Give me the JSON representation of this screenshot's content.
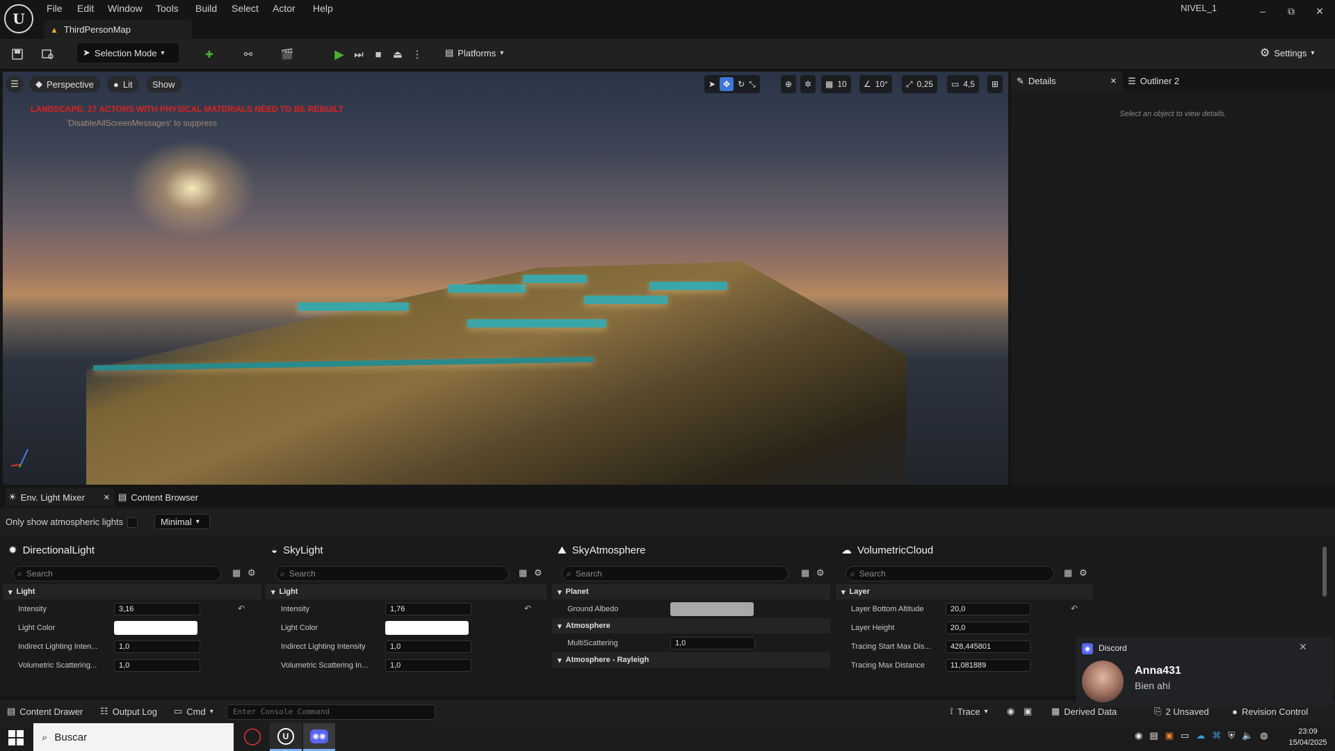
{
  "app": {
    "level": "NIVEL_1",
    "document_tab": "ThirdPersonMap"
  },
  "menu": [
    "File",
    "Edit",
    "Window",
    "Tools",
    "Build",
    "Select",
    "Actor",
    "Help"
  ],
  "window_controls": {
    "minimize": "–",
    "restore": "⧉",
    "close": "✕"
  },
  "toolbar": {
    "selection_mode": "Selection Mode",
    "platforms": "Platforms",
    "settings": "Settings"
  },
  "viewport": {
    "perspective": "Perspective",
    "lit": "Lit",
    "show": "Show",
    "grid_snap": "10",
    "rotation_snap": "10°",
    "scale_snap": "0,25",
    "camera_speed": "4,5",
    "message": "LANDSCAPE: 27 ACTORS WITH PHYSICAL MATERIALS NEED TO BE REBUILT",
    "message_hint": "'DisableAllScreenMessages' to suppress"
  },
  "details": {
    "tab": "Details",
    "outliner_tab": "Outliner 2",
    "empty": "Select an object to view details."
  },
  "bottom_tabs": {
    "light_mixer": "Env. Light Mixer",
    "content_browser": "Content Browser"
  },
  "light_mixer": {
    "only_show_label": "Only show atmospheric lights",
    "view_mode": "Minimal",
    "search_placeholder": "Search",
    "columns": [
      {
        "title": "DirectionalLight",
        "icon": "sun-icon",
        "sections": [
          {
            "name": "Light",
            "rows": [
              {
                "label": "Intensity",
                "value": "3,16"
              },
              {
                "label": "Light Color",
                "color": "#ffffff"
              },
              {
                "label": "Indirect Lighting Inten...",
                "value": "1,0"
              },
              {
                "label": "Volumetric Scattering...",
                "value": "1,0"
              }
            ]
          }
        ]
      },
      {
        "title": "SkyLight",
        "icon": "skylight-icon",
        "sections": [
          {
            "name": "Light",
            "rows": [
              {
                "label": "Intensity",
                "value": "1,76"
              },
              {
                "label": "Light Color",
                "color": "#ffffff"
              },
              {
                "label": "Indirect Lighting Intensity",
                "value": "1,0"
              },
              {
                "label": "Volumetric Scattering In...",
                "value": "1,0"
              }
            ]
          }
        ]
      },
      {
        "title": "SkyAtmosphere",
        "icon": "atmosphere-icon",
        "sections": [
          {
            "name": "Planet",
            "rows": [
              {
                "label": "Ground Albedo",
                "color": "#a8a8a8"
              }
            ]
          },
          {
            "name": "Atmosphere",
            "rows": [
              {
                "label": "MultiScattering",
                "value": "1,0"
              }
            ]
          },
          {
            "name": "Atmosphere - Rayleigh",
            "rows": []
          }
        ]
      },
      {
        "title": "VolumetricCloud",
        "icon": "cloud-icon",
        "sections": [
          {
            "name": "Layer",
            "rows": [
              {
                "label": "Layer Bottom Altitude",
                "value": "20,0"
              },
              {
                "label": "Layer Height",
                "value": "20,0"
              },
              {
                "label": "Tracing Start Max Dis...",
                "value": "428,445801"
              },
              {
                "label": "Tracing Max Distance",
                "value": "11,081889"
              }
            ]
          }
        ]
      }
    ]
  },
  "statusbar": {
    "content_drawer": "Content Drawer",
    "output_log": "Output Log",
    "cmd": "Cmd",
    "console_placeholder": "Enter Console Command",
    "trace": "Trace",
    "derived_data": "Derived Data",
    "unsaved": "2 Unsaved",
    "revision_control": "Revision Control"
  },
  "taskbar": {
    "search_placeholder": "Buscar",
    "time": "23:09",
    "date": "15/04/2025"
  },
  "notification": {
    "app": "Discord",
    "user": "Anna431",
    "message": "Bien ahí"
  },
  "colors": {
    "accent": "#3d78d8",
    "play": "#4caf3a",
    "warning": "#e0201e",
    "discord": "#5865f2"
  }
}
